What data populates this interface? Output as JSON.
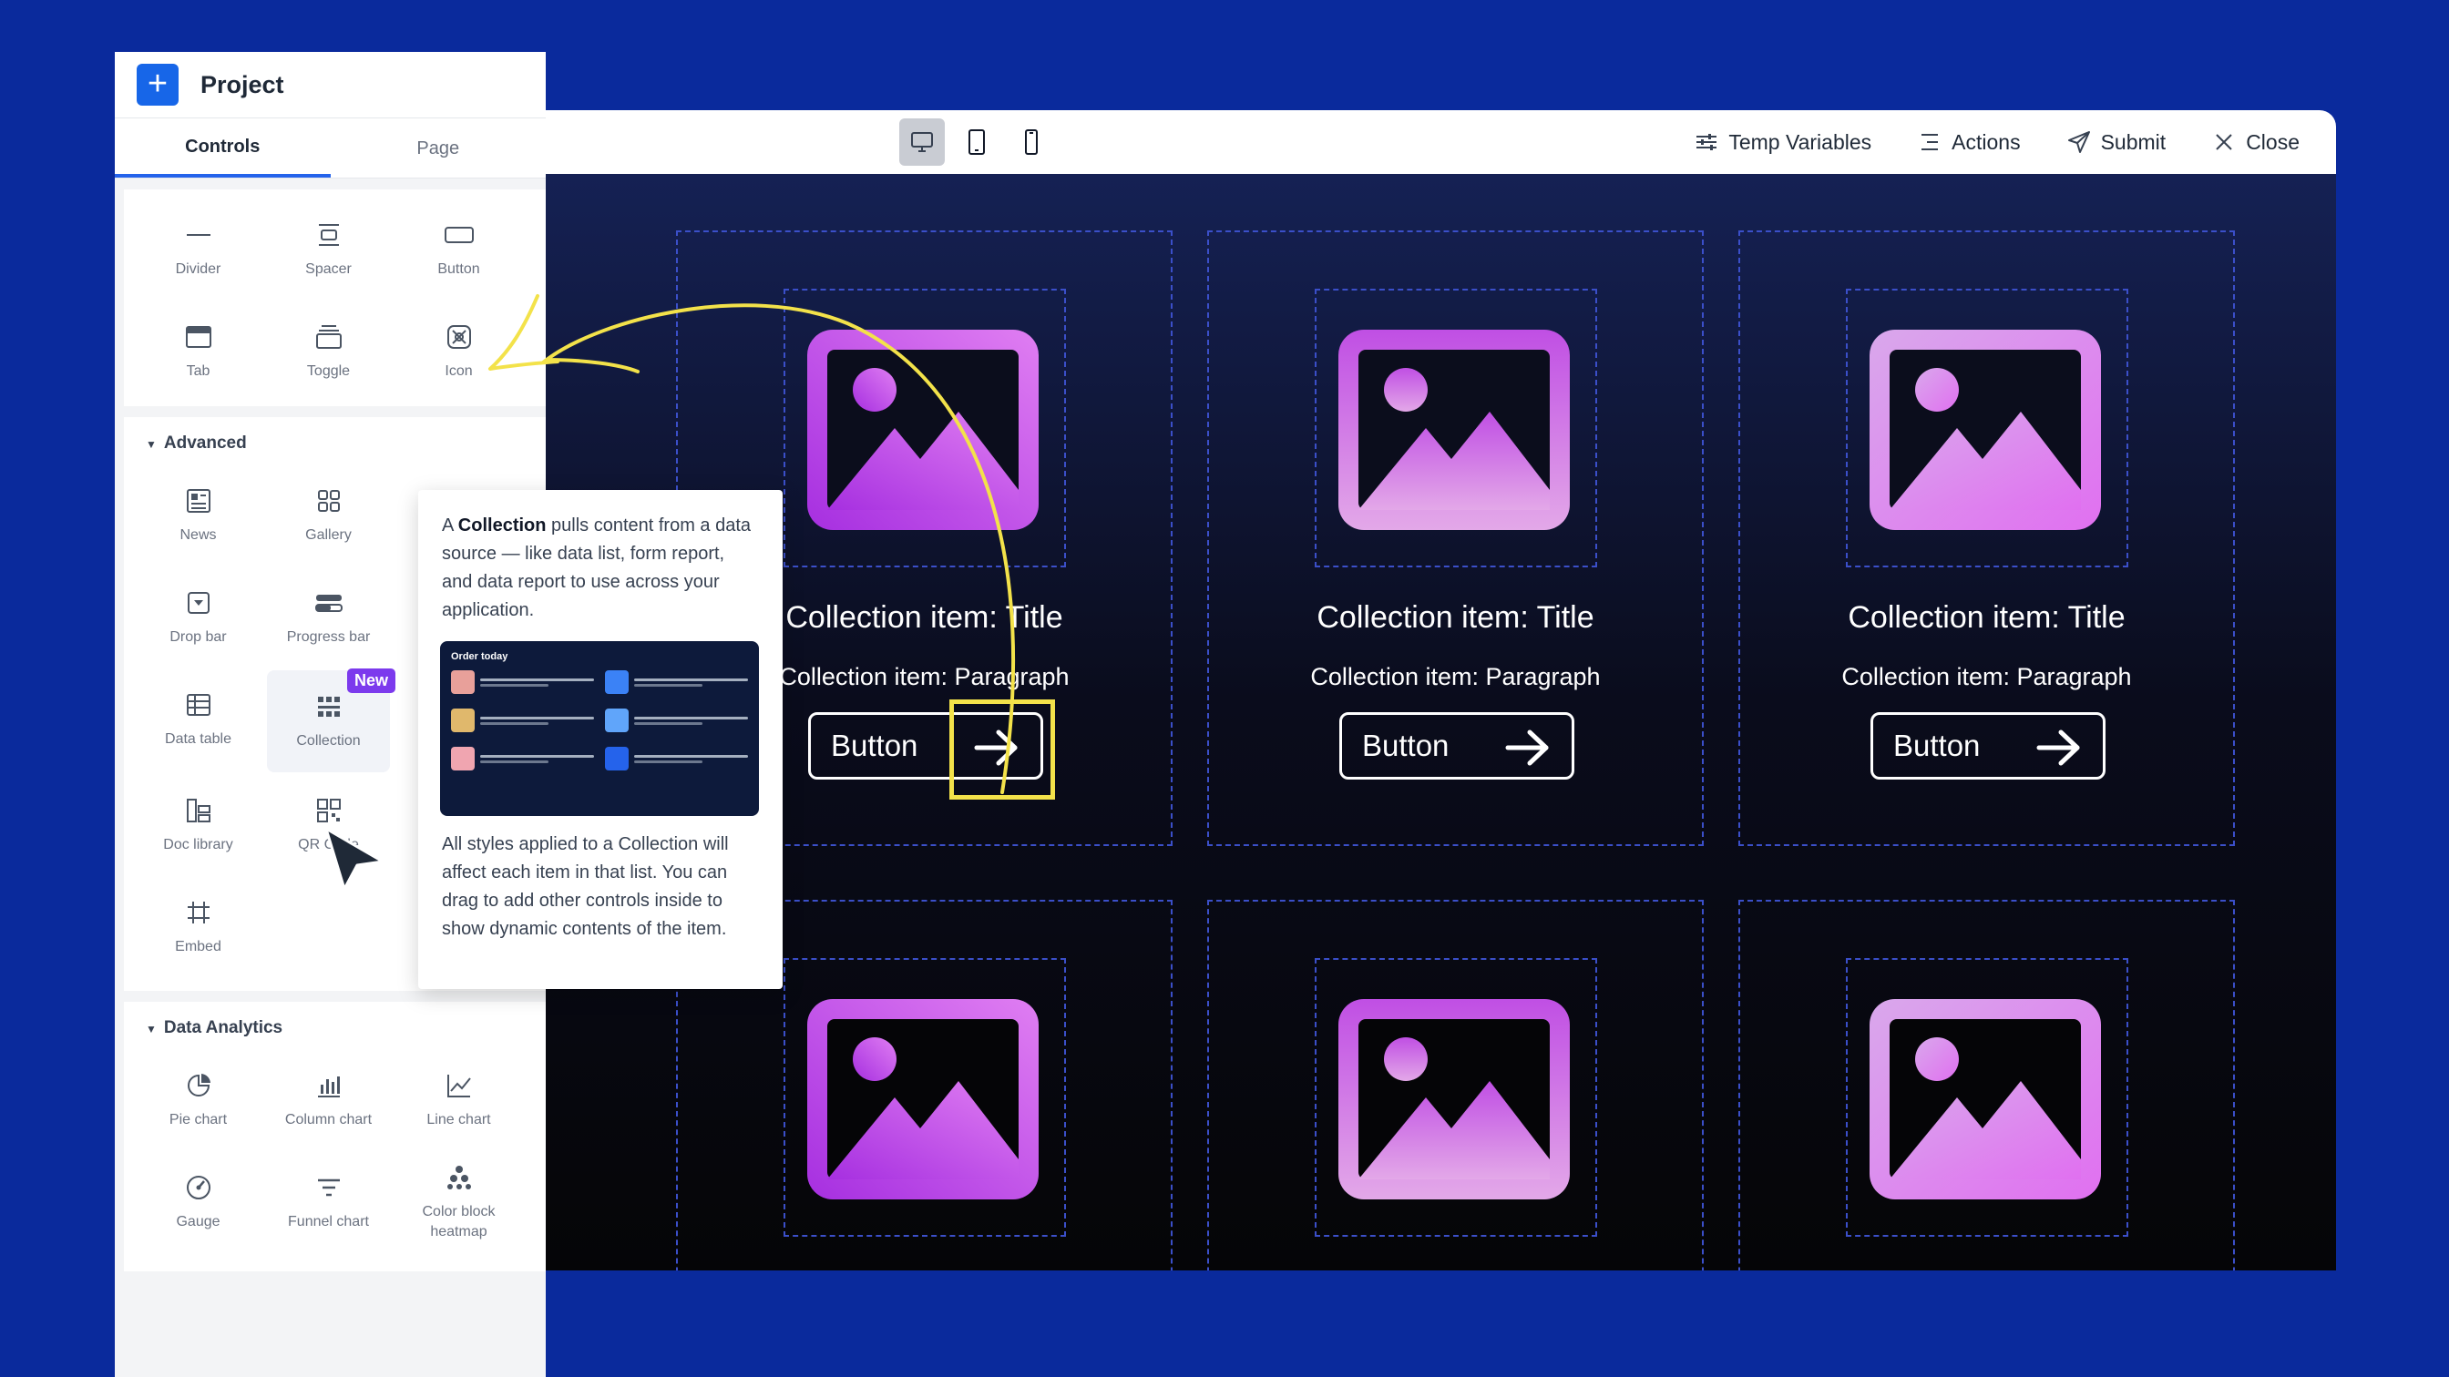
{
  "project": {
    "title": "Project"
  },
  "tabs": [
    {
      "label": "Controls",
      "active": true
    },
    {
      "label": "Page",
      "active": false
    }
  ],
  "basic_controls": [
    {
      "label": "Divider",
      "icon": "divider-icon"
    },
    {
      "label": "Spacer",
      "icon": "spacer-icon"
    },
    {
      "label": "Button",
      "icon": "button-icon"
    },
    {
      "label": "Tab",
      "icon": "tab-icon"
    },
    {
      "label": "Toggle",
      "icon": "toggle-icon"
    },
    {
      "label": "Icon",
      "icon": "icon-icon"
    }
  ],
  "advanced": {
    "title": "Advanced",
    "controls": [
      {
        "label": "News",
        "icon": "news-icon"
      },
      {
        "label": "Gallery",
        "icon": "gallery-icon"
      },
      {
        "label": "Drop bar",
        "icon": "drop-bar-icon"
      },
      {
        "label": "Progress bar",
        "icon": "progress-bar-icon"
      },
      {
        "label": "Data table",
        "icon": "data-table-icon"
      },
      {
        "label": "Collection",
        "icon": "collection-icon",
        "badge": "New"
      },
      {
        "label": "Doc library",
        "icon": "doc-library-icon"
      },
      {
        "label": "QR Code",
        "icon": "qr-code-icon"
      },
      {
        "label": "Embed",
        "icon": "embed-icon"
      }
    ]
  },
  "data_analytics": {
    "title": "Data Analytics",
    "controls": [
      {
        "label": "Pie chart",
        "icon": "pie-chart-icon"
      },
      {
        "label": "Column chart",
        "icon": "column-chart-icon"
      },
      {
        "label": "Line chart",
        "icon": "line-chart-icon"
      },
      {
        "label": "Gauge",
        "icon": "gauge-icon"
      },
      {
        "label": "Funnel chart",
        "icon": "funnel-chart-icon"
      },
      {
        "label": "Color block heatmap",
        "icon": "heatmap-icon"
      }
    ]
  },
  "tooltip": {
    "intro_a": "A ",
    "intro_bold": "Collection",
    "intro_b": " pulls content from a data source — like data list, form report, and data report to use across your application.",
    "preview_title": "Order today",
    "outro": "All styles applied to a Collection will affect each item in that list. You can drag to add other controls inside to show dynamic contents of the item."
  },
  "toolbar": {
    "devices": [
      "desktop-icon",
      "tablet-icon",
      "mobile-icon"
    ],
    "active_device": "desktop",
    "actions": [
      {
        "label": "Temp Variables",
        "icon": "sliders-icon"
      },
      {
        "label": "Actions",
        "icon": "menu-icon"
      },
      {
        "label": "Submit",
        "icon": "send-icon"
      },
      {
        "label": "Close",
        "icon": "close-icon"
      }
    ]
  },
  "collection_items": [
    {
      "title": "Collection item: Title",
      "paragraph": "Collection item: Paragraph",
      "button": "Button"
    },
    {
      "title": "Collection item: Title",
      "paragraph": "Collection item: Paragraph",
      "button": "Button"
    },
    {
      "title": "Collection item: Title",
      "paragraph": "Collection item: Paragraph",
      "button": "Button"
    }
  ],
  "colors": {
    "background": "#0a2a9c",
    "accent": "#1766e8",
    "badge": "#7c3aed",
    "highlight": "#f3e24a",
    "image_gradient": [
      "#b23be0",
      "#e07ef2"
    ]
  }
}
